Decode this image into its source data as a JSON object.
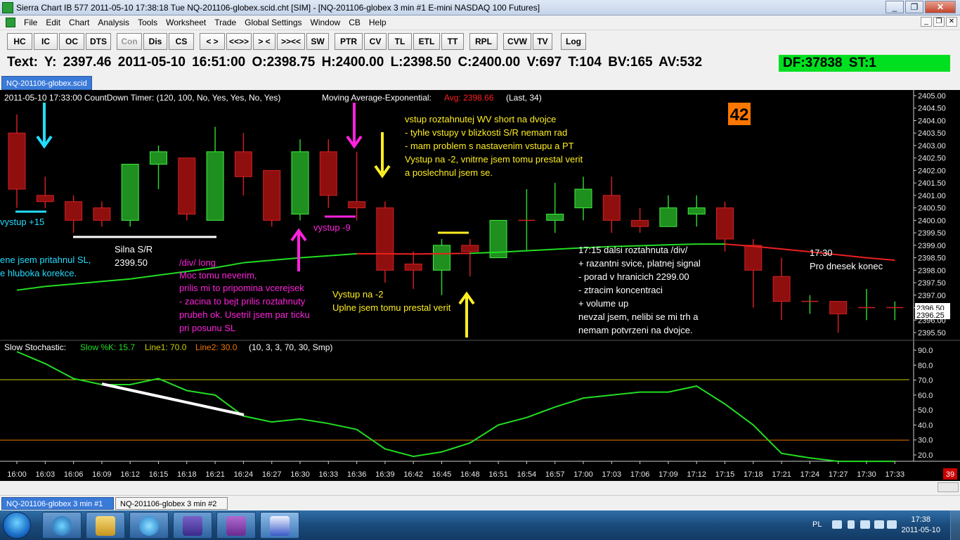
{
  "window": {
    "title": "Sierra Chart IB 577   2011-05-10  17:38:18  Tue    NQ-201106-globex.scid.cht [SIM]  -  [NQ-201106-globex  3 min   #1  E-mini NASDAQ 100 Futures]",
    "minimize": "_",
    "restore": "❐",
    "close": "✕"
  },
  "menu": {
    "items": [
      "File",
      "Edit",
      "Chart",
      "Analysis",
      "Tools",
      "Worksheet",
      "Trade",
      "Global Settings",
      "Window",
      "CB",
      "Help"
    ]
  },
  "toolbar": {
    "buttons": [
      "HC",
      "IC",
      "OC",
      "DTS",
      "Con",
      "Dis",
      "CS",
      "< >",
      "<<>>",
      "> <",
      ">><<",
      "SW",
      "PTR",
      "CV",
      "TL",
      "ETL",
      "TT",
      "RPL",
      "CVW",
      "TV",
      "Log"
    ]
  },
  "infobar": {
    "text": "Text: Y: 2397.46  2011-05-10  16:51:00  O:2398.75  H:2400.00  L:2398.50  C:2400.00  V:697  T:104  BV:165  AV:532",
    "df": "DF:37838  ST:1"
  },
  "doc_tab": "NQ-201106-globex.scid",
  "chart": {
    "header_left": "2011-05-10 17:33:00 CountDown Timer:   (120, 100, No, Yes, Yes, No, Yes)",
    "ma_label": "Moving Average-Exponential:",
    "ma_avg": "Avg: 2398.66",
    "ma_params": "(Last, 34)",
    "countdown_box": "42",
    "stoch_label": "Slow Stochastic:",
    "stoch_k": "Slow %K: 15.7",
    "stoch_l1": "Line1: 70.0",
    "stoch_l2": "Line2: 30.0",
    "stoch_params": "(10, 3, 3, 70, 30, Smp)",
    "scroll_badge": "39",
    "price_badge_1": "2396.50",
    "price_badge_2": "2396.25",
    "annotations": {
      "vystup15": "vystup +15",
      "sl_line1": "ene jsem pritahnul SL,",
      "sl_line2": "e hluboka korekce.",
      "silna1": "Silna S/R",
      "silna2": "2399.50",
      "vystup9": "vystup -9",
      "div_long": [
        "/div/ long",
        "Moc tomu neverim,",
        "prilis mi to pripomina vcerejsek",
        "- zacina to bejt prilis roztahnuty",
        "prubeh ok. Usetril jsem par ticku",
        "pri posunu SL"
      ],
      "vstup_short": [
        "vstup roztahnutej WV short na dvojce",
        "- tyhle vstupy v blizkosti S/R nemam rad",
        "- mam problem s nastavenim vstupu a PT",
        "Vystup na -2, vnitrne jsem tomu prestal verit",
        "a poslechnul jsem se."
      ],
      "vystup2": [
        "Vystup na -2",
        "Uplne jsem tomu prestal verit"
      ],
      "div_1715": [
        "17:15 dalsi roztahnuta /div/",
        "+ razantni svice, platnej signal",
        "- porad v hranicich 2299.00",
        "- ztracim koncentraci",
        "+ volume up",
        "nevzal jsem, nelibi se mi trh a",
        "nemam potvrzeni na dvojce."
      ],
      "konec": [
        "17:30",
        "Pro dnesek konec"
      ]
    }
  },
  "chart_data": [
    {
      "type": "candlestick",
      "x": [
        "16:00",
        "16:03",
        "16:06",
        "16:09",
        "16:12",
        "16:15",
        "16:18",
        "16:21",
        "16:24",
        "16:27",
        "16:30",
        "16:33",
        "16:36",
        "16:39",
        "16:42",
        "16:45",
        "16:48",
        "16:51",
        "16:54",
        "16:57",
        "17:00",
        "17:03",
        "17:06",
        "17:09",
        "17:12",
        "17:15",
        "17:18",
        "17:21",
        "17:24",
        "17:27",
        "17:30",
        "17:33"
      ],
      "ohlc": [
        [
          2403.5,
          2404.25,
          2400.5,
          2401.25
        ],
        [
          2401.0,
          2401.75,
          2400.5,
          2400.75
        ],
        [
          2400.75,
          2401.0,
          2399.5,
          2400.0
        ],
        [
          2400.5,
          2400.75,
          2399.75,
          2400.0
        ],
        [
          2400.0,
          2402.25,
          2399.75,
          2402.25
        ],
        [
          2402.25,
          2403.0,
          2401.25,
          2402.75
        ],
        [
          2402.5,
          2402.5,
          2400.0,
          2400.25
        ],
        [
          2400.0,
          2403.75,
          2400.0,
          2402.75
        ],
        [
          2402.75,
          2403.5,
          2401.0,
          2401.75
        ],
        [
          2402.0,
          2402.0,
          2399.75,
          2400.0
        ],
        [
          2400.25,
          2403.25,
          2400.0,
          2402.75
        ],
        [
          2402.75,
          2403.25,
          2400.5,
          2401.0
        ],
        [
          2400.75,
          2402.75,
          2400.0,
          2400.5
        ],
        [
          2400.5,
          2400.75,
          2397.5,
          2398.0
        ],
        [
          2398.25,
          2398.75,
          2397.25,
          2398.0
        ],
        [
          2398.0,
          2399.25,
          2397.0,
          2399.0
        ],
        [
          2399.0,
          2399.25,
          2397.75,
          2398.75
        ],
        [
          2398.5,
          2400.0,
          2398.5,
          2400.0
        ],
        [
          2400.0,
          2401.25,
          2398.75,
          2400.0
        ],
        [
          2400.0,
          2401.5,
          2399.5,
          2400.25
        ],
        [
          2400.5,
          2401.75,
          2400.0,
          2401.25
        ],
        [
          2401.0,
          2401.75,
          2399.5,
          2400.0
        ],
        [
          2400.0,
          2400.5,
          2399.5,
          2399.75
        ],
        [
          2399.75,
          2401.0,
          2399.75,
          2400.5
        ],
        [
          2400.25,
          2401.0,
          2399.75,
          2400.5
        ],
        [
          2400.5,
          2400.75,
          2398.75,
          2399.25
        ],
        [
          2399.0,
          2399.25,
          2396.5,
          2398.0
        ],
        [
          2397.75,
          2398.5,
          2396.0,
          2396.75
        ],
        [
          2396.75,
          2397.0,
          2396.25,
          2396.75
        ],
        [
          2396.75,
          2396.75,
          2395.5,
          2396.25
        ],
        [
          2396.5,
          2397.25,
          2396.0,
          2396.5
        ],
        [
          2396.5,
          2396.75,
          2396.0,
          2396.5
        ]
      ],
      "ema_34": [
        2397.2,
        2397.35,
        2397.45,
        2397.55,
        2397.65,
        2397.8,
        2397.95,
        2398.1,
        2398.3,
        2398.4,
        2398.5,
        2398.58,
        2398.66,
        2398.66,
        2398.65,
        2398.66,
        2398.68,
        2398.72,
        2398.78,
        2398.84,
        2398.9,
        2398.95,
        2398.98,
        2399.02,
        2399.05,
        2399.05,
        2398.96,
        2398.85,
        2398.74,
        2398.62,
        2398.5,
        2398.4
      ],
      "ylim": [
        2395.25,
        2405.0
      ],
      "y_ticks": [
        2395.5,
        2396.0,
        2396.5,
        2397.0,
        2397.5,
        2398.0,
        2398.5,
        2399.0,
        2399.5,
        2400.0,
        2400.5,
        2401.0,
        2401.5,
        2402.0,
        2402.5,
        2403.0,
        2403.5,
        2404.0,
        2404.5,
        2405.0
      ]
    },
    {
      "type": "line",
      "name": "Slow %K",
      "x": [
        "16:00",
        "16:03",
        "16:06",
        "16:09",
        "16:12",
        "16:15",
        "16:18",
        "16:21",
        "16:24",
        "16:27",
        "16:30",
        "16:33",
        "16:36",
        "16:39",
        "16:42",
        "16:45",
        "16:48",
        "16:51",
        "16:54",
        "16:57",
        "17:00",
        "17:03",
        "17:06",
        "17:09",
        "17:12",
        "17:15",
        "17:18",
        "17:21",
        "17:24",
        "17:27",
        "17:30",
        "17:33"
      ],
      "values": [
        89,
        81,
        71,
        67,
        67,
        71,
        63,
        60,
        46,
        42,
        44,
        41,
        37,
        24,
        19,
        22,
        28,
        40,
        45,
        52,
        58,
        60,
        62,
        62,
        66,
        54,
        40,
        21,
        18,
        15.7,
        15.7,
        15.7
      ],
      "line1": 70.0,
      "line2": 30.0,
      "ylim": [
        16,
        92
      ],
      "y_ticks": [
        20,
        30,
        40,
        50,
        60,
        70,
        80,
        90
      ]
    }
  ],
  "chart_tabs": [
    "NQ-201106-globex  3 min   #1",
    "NQ-201106-globex  3 min   #2"
  ],
  "tray": {
    "lang": "PL",
    "time": "17:38",
    "date": "2011-05-10"
  },
  "colors": {
    "up_candle": "#1f8f1f",
    "down_candle": "#8f0f0f",
    "ema": "#22dd22",
    "ema_down": "#ee2020",
    "stoch": "#22dd22",
    "annotation_yellow": "#ffee22",
    "annotation_magenta": "#ff22dd",
    "annotation_cyan": "#22ddff",
    "countdown_bg": "#ff7700"
  }
}
